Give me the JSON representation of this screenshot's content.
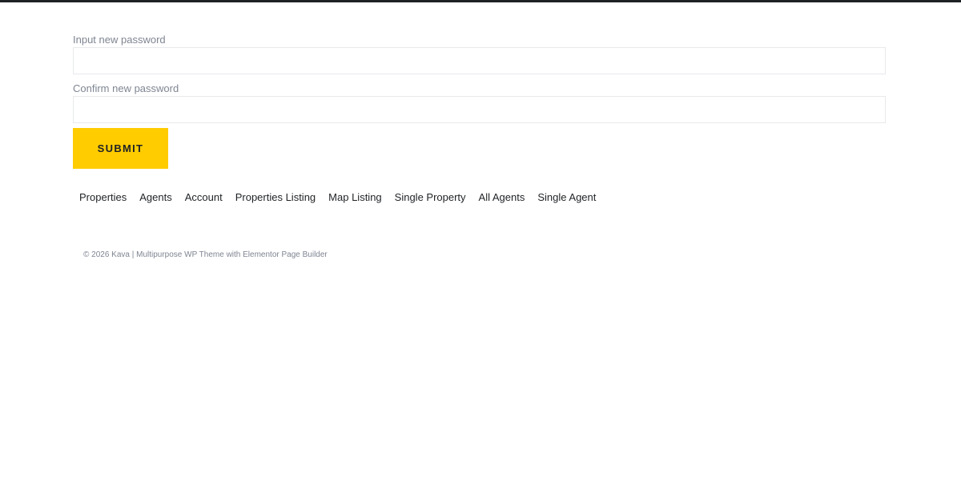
{
  "form": {
    "new_password_label": "Input new password",
    "new_password_value": "",
    "confirm_password_label": "Confirm new password",
    "confirm_password_value": "",
    "submit_label": "SUBMIT"
  },
  "footer": {
    "nav": [
      {
        "label": "Properties"
      },
      {
        "label": "Agents"
      },
      {
        "label": "Account"
      },
      {
        "label": "Properties Listing"
      },
      {
        "label": "Map Listing"
      },
      {
        "label": "Single Property"
      },
      {
        "label": "All Agents"
      },
      {
        "label": "Single Agent"
      }
    ],
    "copyright": "© 2026 Kava | Multipurpose WP Theme with Elementor Page Builder"
  },
  "colors": {
    "accent": "#ffcc00",
    "text_dark": "#1f2225",
    "text_muted": "#7f8592",
    "border": "#e8e9ec"
  }
}
